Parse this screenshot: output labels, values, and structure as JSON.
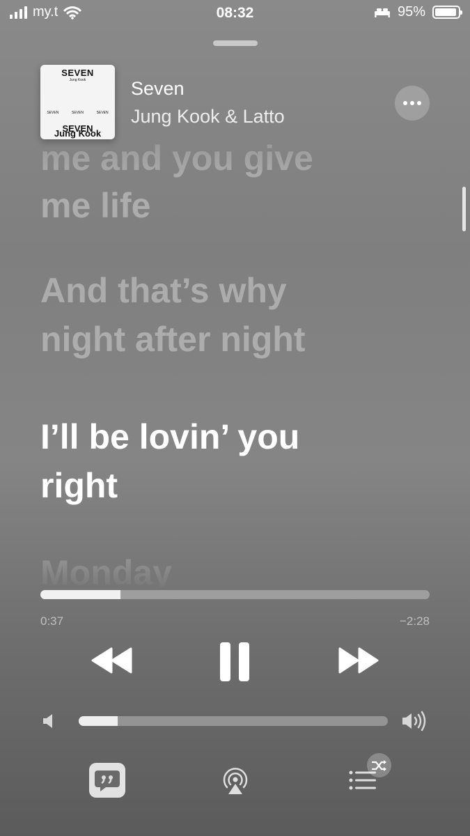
{
  "status_bar": {
    "carrier": "my.t",
    "time": "08:32",
    "battery": "95%",
    "battery_level": 0.95
  },
  "now_playing": {
    "title": "Seven",
    "artist": "Jung Kook & Latto",
    "album_art": {
      "top_text": "SEVEN",
      "sub_text": "Jung Kook",
      "mid_left": "SEVEN",
      "mid_center": "SEVEN",
      "mid_right": "SEVEN",
      "bottom_text": "SEVEN",
      "bottom_text_2": "Jung Kook"
    }
  },
  "lyrics": {
    "lines": [
      {
        "text": "me and you give",
        "state": "past"
      },
      {
        "text": "me life",
        "state": "past"
      },
      {
        "text": "And that’s why",
        "state": "past"
      },
      {
        "text": "night after night",
        "state": "past"
      },
      {
        "text": "I’ll be lovin’ you",
        "state": "current"
      },
      {
        "text": "right",
        "state": "current"
      },
      {
        "text": "Monday",
        "state": "upcoming"
      }
    ]
  },
  "playback": {
    "elapsed": "0:37",
    "remaining": "−2:28",
    "progress": 0.205
  },
  "volume": {
    "level": 0.125
  },
  "icons": {
    "more": "ellipsis-icon",
    "rewind": "rewind-icon",
    "pause": "pause-icon",
    "forward": "fast-forward-icon",
    "volume_low": "speaker-low-icon",
    "volume_high": "speaker-high-icon",
    "lyrics": "lyrics-quote-icon",
    "airplay": "airplay-icon",
    "queue": "queue-list-icon",
    "shuffle": "shuffle-icon"
  }
}
